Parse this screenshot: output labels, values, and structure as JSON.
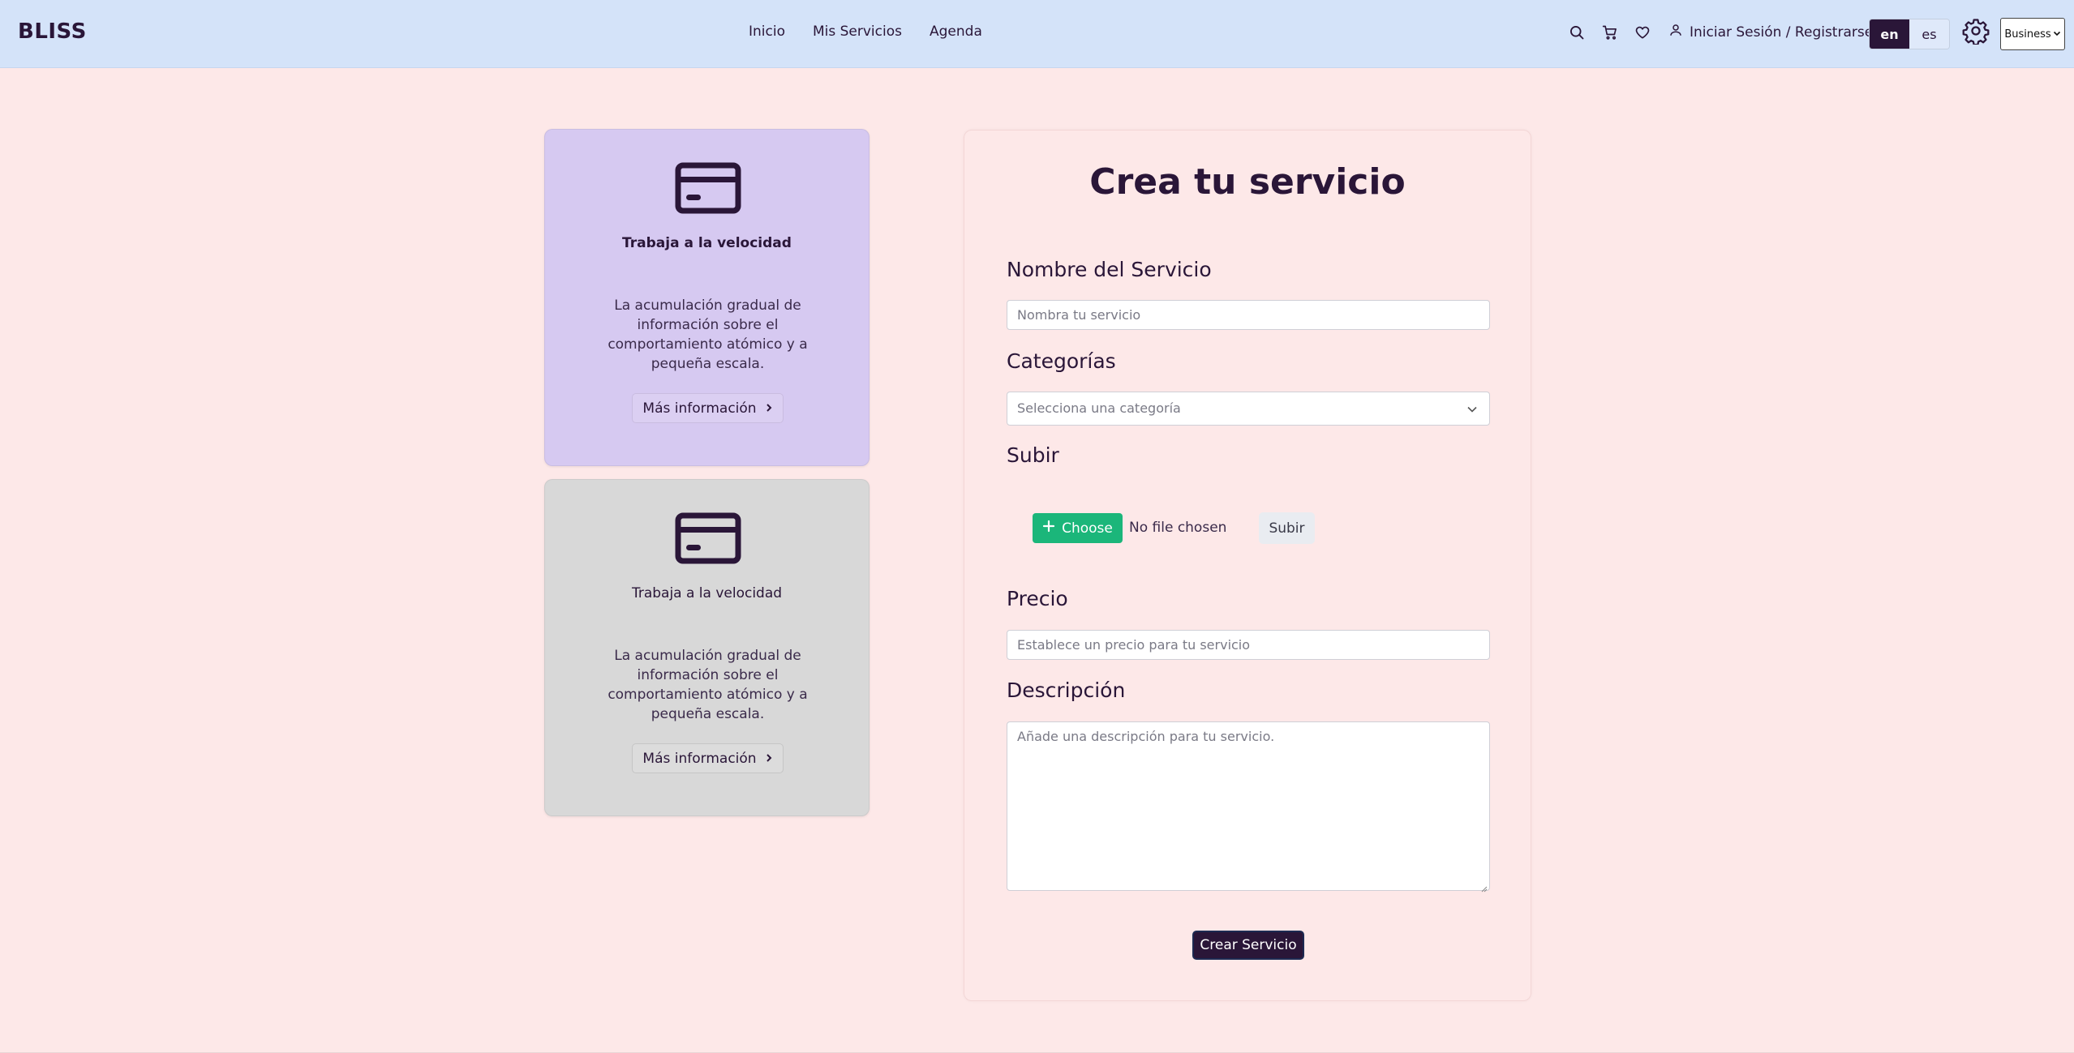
{
  "navbar": {
    "brand": "BLISS",
    "links": [
      "Inicio",
      "Mis Servicios",
      "Agenda"
    ],
    "icons": [
      "search-icon",
      "cart-icon",
      "heart-icon"
    ],
    "login_label": "Iniciar Sesión / Registrarse",
    "languages": [
      {
        "code": "en",
        "active": true
      },
      {
        "code": "es",
        "active": false
      }
    ],
    "theme_select": "Business"
  },
  "cards": [
    {
      "title": "Trabaja a la velocidad",
      "text": "La acumulación gradual de información sobre el comportamiento atómico y a pequeña escala.",
      "button": "Más información",
      "background": "#d6c9f1"
    },
    {
      "title": "Trabaja a la velocidad",
      "text": "La acumulación gradual de información sobre el comportamiento atómico y a pequeña escala.",
      "button": "Más información",
      "background": "#d8d8d8"
    }
  ],
  "form": {
    "title": "Crea tu servicio",
    "name_label": "Nombre del Servicio",
    "name_placeholder": "Nombra tu servicio",
    "category_label": "Categorías",
    "category_selected": "Selecciona una categoría",
    "upload_label": "Subir",
    "choose_label": "Choose",
    "no_file": "No file chosen",
    "upload_button": "Subir",
    "price_label": "Precio",
    "price_placeholder": "Establece un precio para tu servicio",
    "description_label": "Descripción",
    "description_placeholder": "Añade una descripción para tu servicio.",
    "submit": "Crear Servicio"
  },
  "colors": {
    "navbar_bg": "#d4e3f9",
    "page_bg": "#fde8e8",
    "primary": "#2a1638",
    "accent_green": "#1bb67a"
  }
}
